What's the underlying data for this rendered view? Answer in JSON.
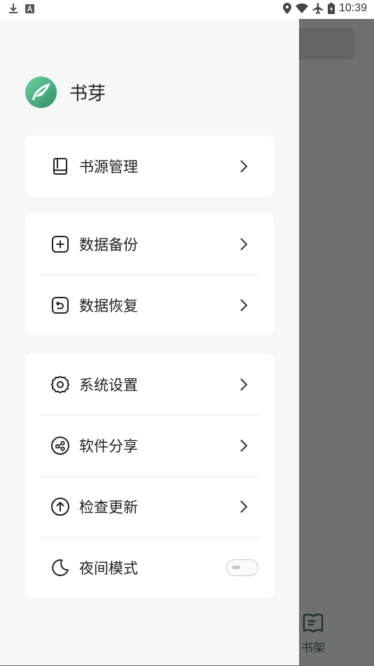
{
  "status_bar": {
    "time": "10:39",
    "icons": [
      "download-icon",
      "font-icon",
      "location-icon",
      "wifi-icon",
      "airplane-icon",
      "battery-icon"
    ]
  },
  "drawer": {
    "app_name": "书芽",
    "groups": [
      {
        "items": [
          {
            "label": "书源管理",
            "icon": "book-icon"
          }
        ]
      },
      {
        "items": [
          {
            "label": "数据备份",
            "icon": "plus-square-icon"
          },
          {
            "label": "数据恢复",
            "icon": "restore-icon"
          }
        ]
      },
      {
        "items": [
          {
            "label": "系统设置",
            "icon": "gear-icon"
          },
          {
            "label": "软件分享",
            "icon": "share-icon"
          },
          {
            "label": "检查更新",
            "icon": "arrow-up-circle-icon"
          },
          {
            "label": "夜间模式",
            "icon": "moon-icon",
            "toggle": false
          }
        ]
      }
    ]
  },
  "background_app": {
    "bottom_nav": {
      "label": "书架",
      "icon": "bookshelf-icon"
    }
  },
  "colors": {
    "accent": "#3ea97a",
    "drawer_bg": "#f7f7f7",
    "scrim": "#6f6f6f"
  }
}
